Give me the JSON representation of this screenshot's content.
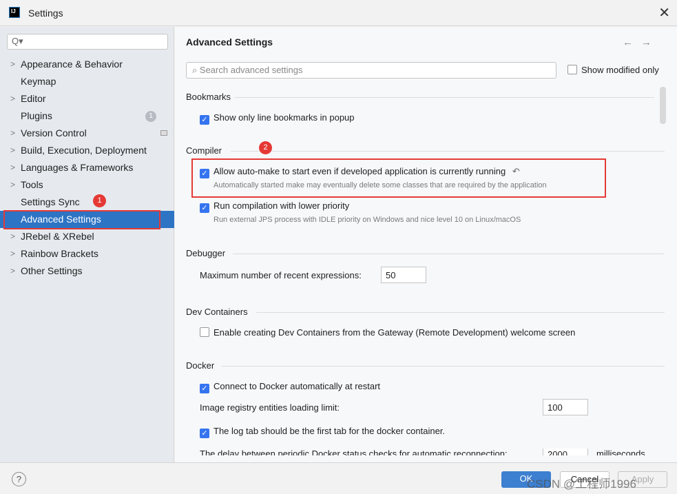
{
  "window": {
    "title": "Settings",
    "logo": "IJ"
  },
  "sidebar": {
    "search_placeholder": "Q▾",
    "items": [
      {
        "label": "Appearance & Behavior",
        "expandable": true
      },
      {
        "label": "Keymap",
        "expandable": false
      },
      {
        "label": "Editor",
        "expandable": true
      },
      {
        "label": "Plugins",
        "expandable": false,
        "badge": "1"
      },
      {
        "label": "Version Control",
        "expandable": true
      },
      {
        "label": "Build, Execution, Deployment",
        "expandable": true
      },
      {
        "label": "Languages & Frameworks",
        "expandable": true
      },
      {
        "label": "Tools",
        "expandable": true
      },
      {
        "label": "Settings Sync",
        "expandable": false
      },
      {
        "label": "Advanced Settings",
        "expandable": false,
        "selected": true
      },
      {
        "label": "JRebel & XRebel",
        "expandable": true
      },
      {
        "label": "Rainbow Brackets",
        "expandable": true
      },
      {
        "label": "Other Settings",
        "expandable": true
      }
    ],
    "annotation": "1"
  },
  "main": {
    "title": "Advanced Settings",
    "search_placeholder": "Search advanced settings",
    "show_modified": "Show modified only",
    "bookmarks": {
      "title": "Bookmarks",
      "show_line": "Show only line bookmarks in popup"
    },
    "compiler": {
      "title": "Compiler",
      "annotation": "2",
      "auto_make": "Allow auto-make to start even if developed application is currently running",
      "auto_make_desc": "Automatically started make may eventually delete some classes that are required by the application",
      "lower_priority": "Run compilation with lower priority",
      "lower_priority_desc": "Run external JPS process with IDLE priority on Windows and nice level 10 on Linux/macOS"
    },
    "debugger": {
      "title": "Debugger",
      "max_label": "Maximum number of recent expressions:",
      "max_value": "50"
    },
    "dev_containers": {
      "title": "Dev Containers",
      "enable": "Enable creating Dev Containers from the Gateway (Remote Development) welcome screen"
    },
    "docker": {
      "title": "Docker",
      "connect": "Connect to Docker automatically at restart",
      "limit_label": "Image registry entities loading limit:",
      "limit_value": "100",
      "log_tab": "The log tab should be the first tab for the docker container.",
      "delay_label": "The delay between periodic Docker status checks for automatic reconnection:",
      "delay_value": "2000",
      "delay_unit": "milliseconds"
    }
  },
  "footer": {
    "help": "?",
    "ok": "OK",
    "cancel": "Cancel",
    "apply": "Apply",
    "watermark": "CSDN @工程师1996"
  }
}
